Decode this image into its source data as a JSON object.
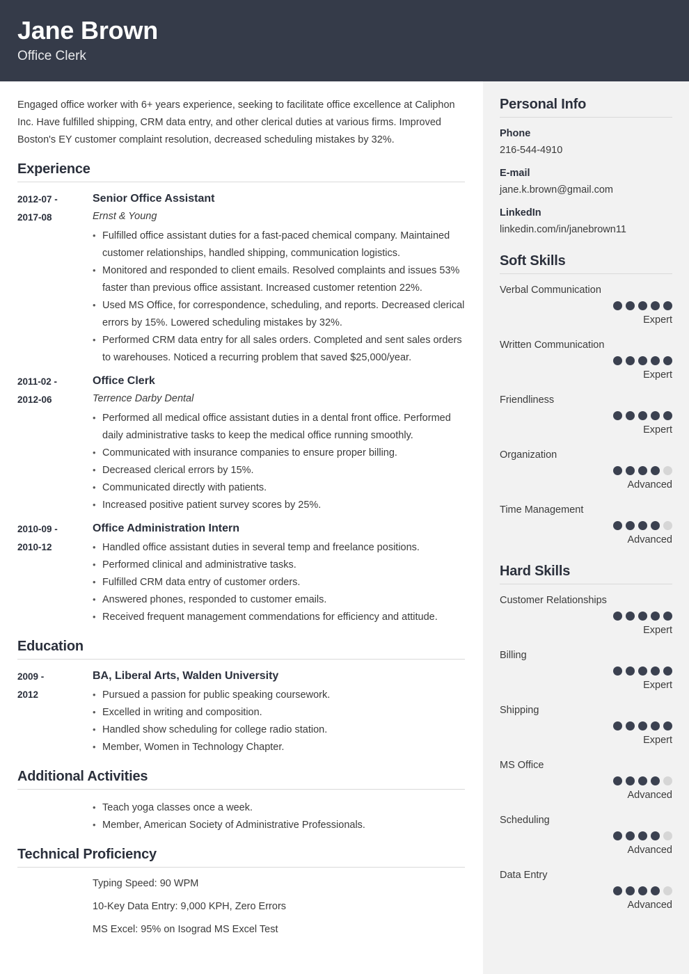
{
  "header": {
    "name": "Jane Brown",
    "job_title": "Office Clerk",
    "background_color": "#353b49"
  },
  "summary": "Engaged office worker with 6+ years experience, seeking to facilitate office excellence at Caliphon Inc. Have fulfilled shipping, CRM data entry, and other clerical duties at various firms. Improved Boston's EY customer complaint resolution, decreased scheduling mistakes by 32%.",
  "sections": {
    "experience": {
      "heading": "Experience",
      "entries": [
        {
          "dates": "2012-07 - 2017-08",
          "role": "Senior Office Assistant",
          "org": "Ernst & Young",
          "bullets": [
            "Fulfilled office assistant duties for a fast-paced chemical company. Maintained customer relationships, handled shipping, communication logistics.",
            "Monitored and responded to client emails. Resolved complaints and issues 53% faster than previous office assistant. Increased customer retention 22%.",
            "Used MS Office, for correspondence, scheduling, and reports. Decreased clerical errors by 15%. Lowered scheduling mistakes by 32%.",
            "Performed CRM data entry for all sales orders. Completed and sent sales orders to warehouses. Noticed a recurring problem that saved $25,000/year."
          ]
        },
        {
          "dates": "2011-02 - 2012-06",
          "role": "Office Clerk",
          "org": "Terrence Darby Dental",
          "bullets": [
            "Performed all medical office assistant duties in a dental front office. Performed daily administrative tasks to keep the medical office running smoothly.",
            "Communicated with insurance companies to ensure proper billing.",
            "Decreased clerical errors by 15%.",
            "Communicated directly with patients.",
            "Increased positive patient survey scores by 25%."
          ]
        },
        {
          "dates": "2010-09 - 2010-12",
          "role": "Office Administration Intern",
          "org": "",
          "bullets": [
            "Handled office assistant duties in several temp and freelance positions.",
            "Performed clinical and administrative tasks.",
            "Fulfilled CRM data entry of customer orders.",
            "Answered phones, responded to customer emails.",
            "Received frequent management commendations for efficiency and attitude."
          ]
        }
      ]
    },
    "education": {
      "heading": "Education",
      "entries": [
        {
          "dates": "2009 - 2012",
          "role": "BA, Liberal Arts, Walden University",
          "org": "",
          "bullets": [
            "Pursued a passion for public speaking coursework.",
            "Excelled in writing and composition.",
            "Handled show scheduling for college radio station.",
            "Member, Women in Technology Chapter."
          ]
        }
      ]
    },
    "additional_activities": {
      "heading": "Additional Activities",
      "bullets": [
        "Teach yoga classes once a week.",
        "Member, American Society of Administrative Professionals."
      ]
    },
    "technical_proficiency": {
      "heading": "Technical Proficiency",
      "items": [
        "Typing Speed: 90 WPM",
        "10-Key Data Entry: 9,000 KPH, Zero Errors",
        "MS Excel: 95% on Isograd MS Excel Test"
      ]
    }
  },
  "sidebar": {
    "personal_info": {
      "heading": "Personal Info",
      "fields": [
        {
          "label": "Phone",
          "value": "216-544-4910"
        },
        {
          "label": "E-mail",
          "value": "jane.k.brown@gmail.com"
        },
        {
          "label": "LinkedIn",
          "value": "linkedin.com/in/janebrown11"
        }
      ]
    },
    "soft_skills": {
      "heading": "Soft Skills",
      "max_dots": 5,
      "skills": [
        {
          "name": "Verbal Communication",
          "filled": 5,
          "level": "Expert"
        },
        {
          "name": "Written Communication",
          "filled": 5,
          "level": "Expert"
        },
        {
          "name": "Friendliness",
          "filled": 5,
          "level": "Expert"
        },
        {
          "name": "Organization",
          "filled": 4,
          "level": "Advanced"
        },
        {
          "name": "Time Management",
          "filled": 4,
          "level": "Advanced"
        }
      ]
    },
    "hard_skills": {
      "heading": "Hard Skills",
      "max_dots": 5,
      "skills": [
        {
          "name": "Customer Relationships",
          "filled": 5,
          "level": "Expert"
        },
        {
          "name": "Billing",
          "filled": 5,
          "level": "Expert"
        },
        {
          "name": "Shipping",
          "filled": 5,
          "level": "Expert"
        },
        {
          "name": "MS Office",
          "filled": 4,
          "level": "Advanced"
        },
        {
          "name": "Scheduling",
          "filled": 4,
          "level": "Advanced"
        },
        {
          "name": "Data Entry",
          "filled": 4,
          "level": "Advanced"
        }
      ]
    },
    "background_color": "#f2f2f2"
  },
  "colors": {
    "dark": "#353b49",
    "dot_on": "#3b4150",
    "dot_off": "#d6d6d6",
    "rule": "#d9d9d9",
    "text": "#3b3b3b"
  }
}
